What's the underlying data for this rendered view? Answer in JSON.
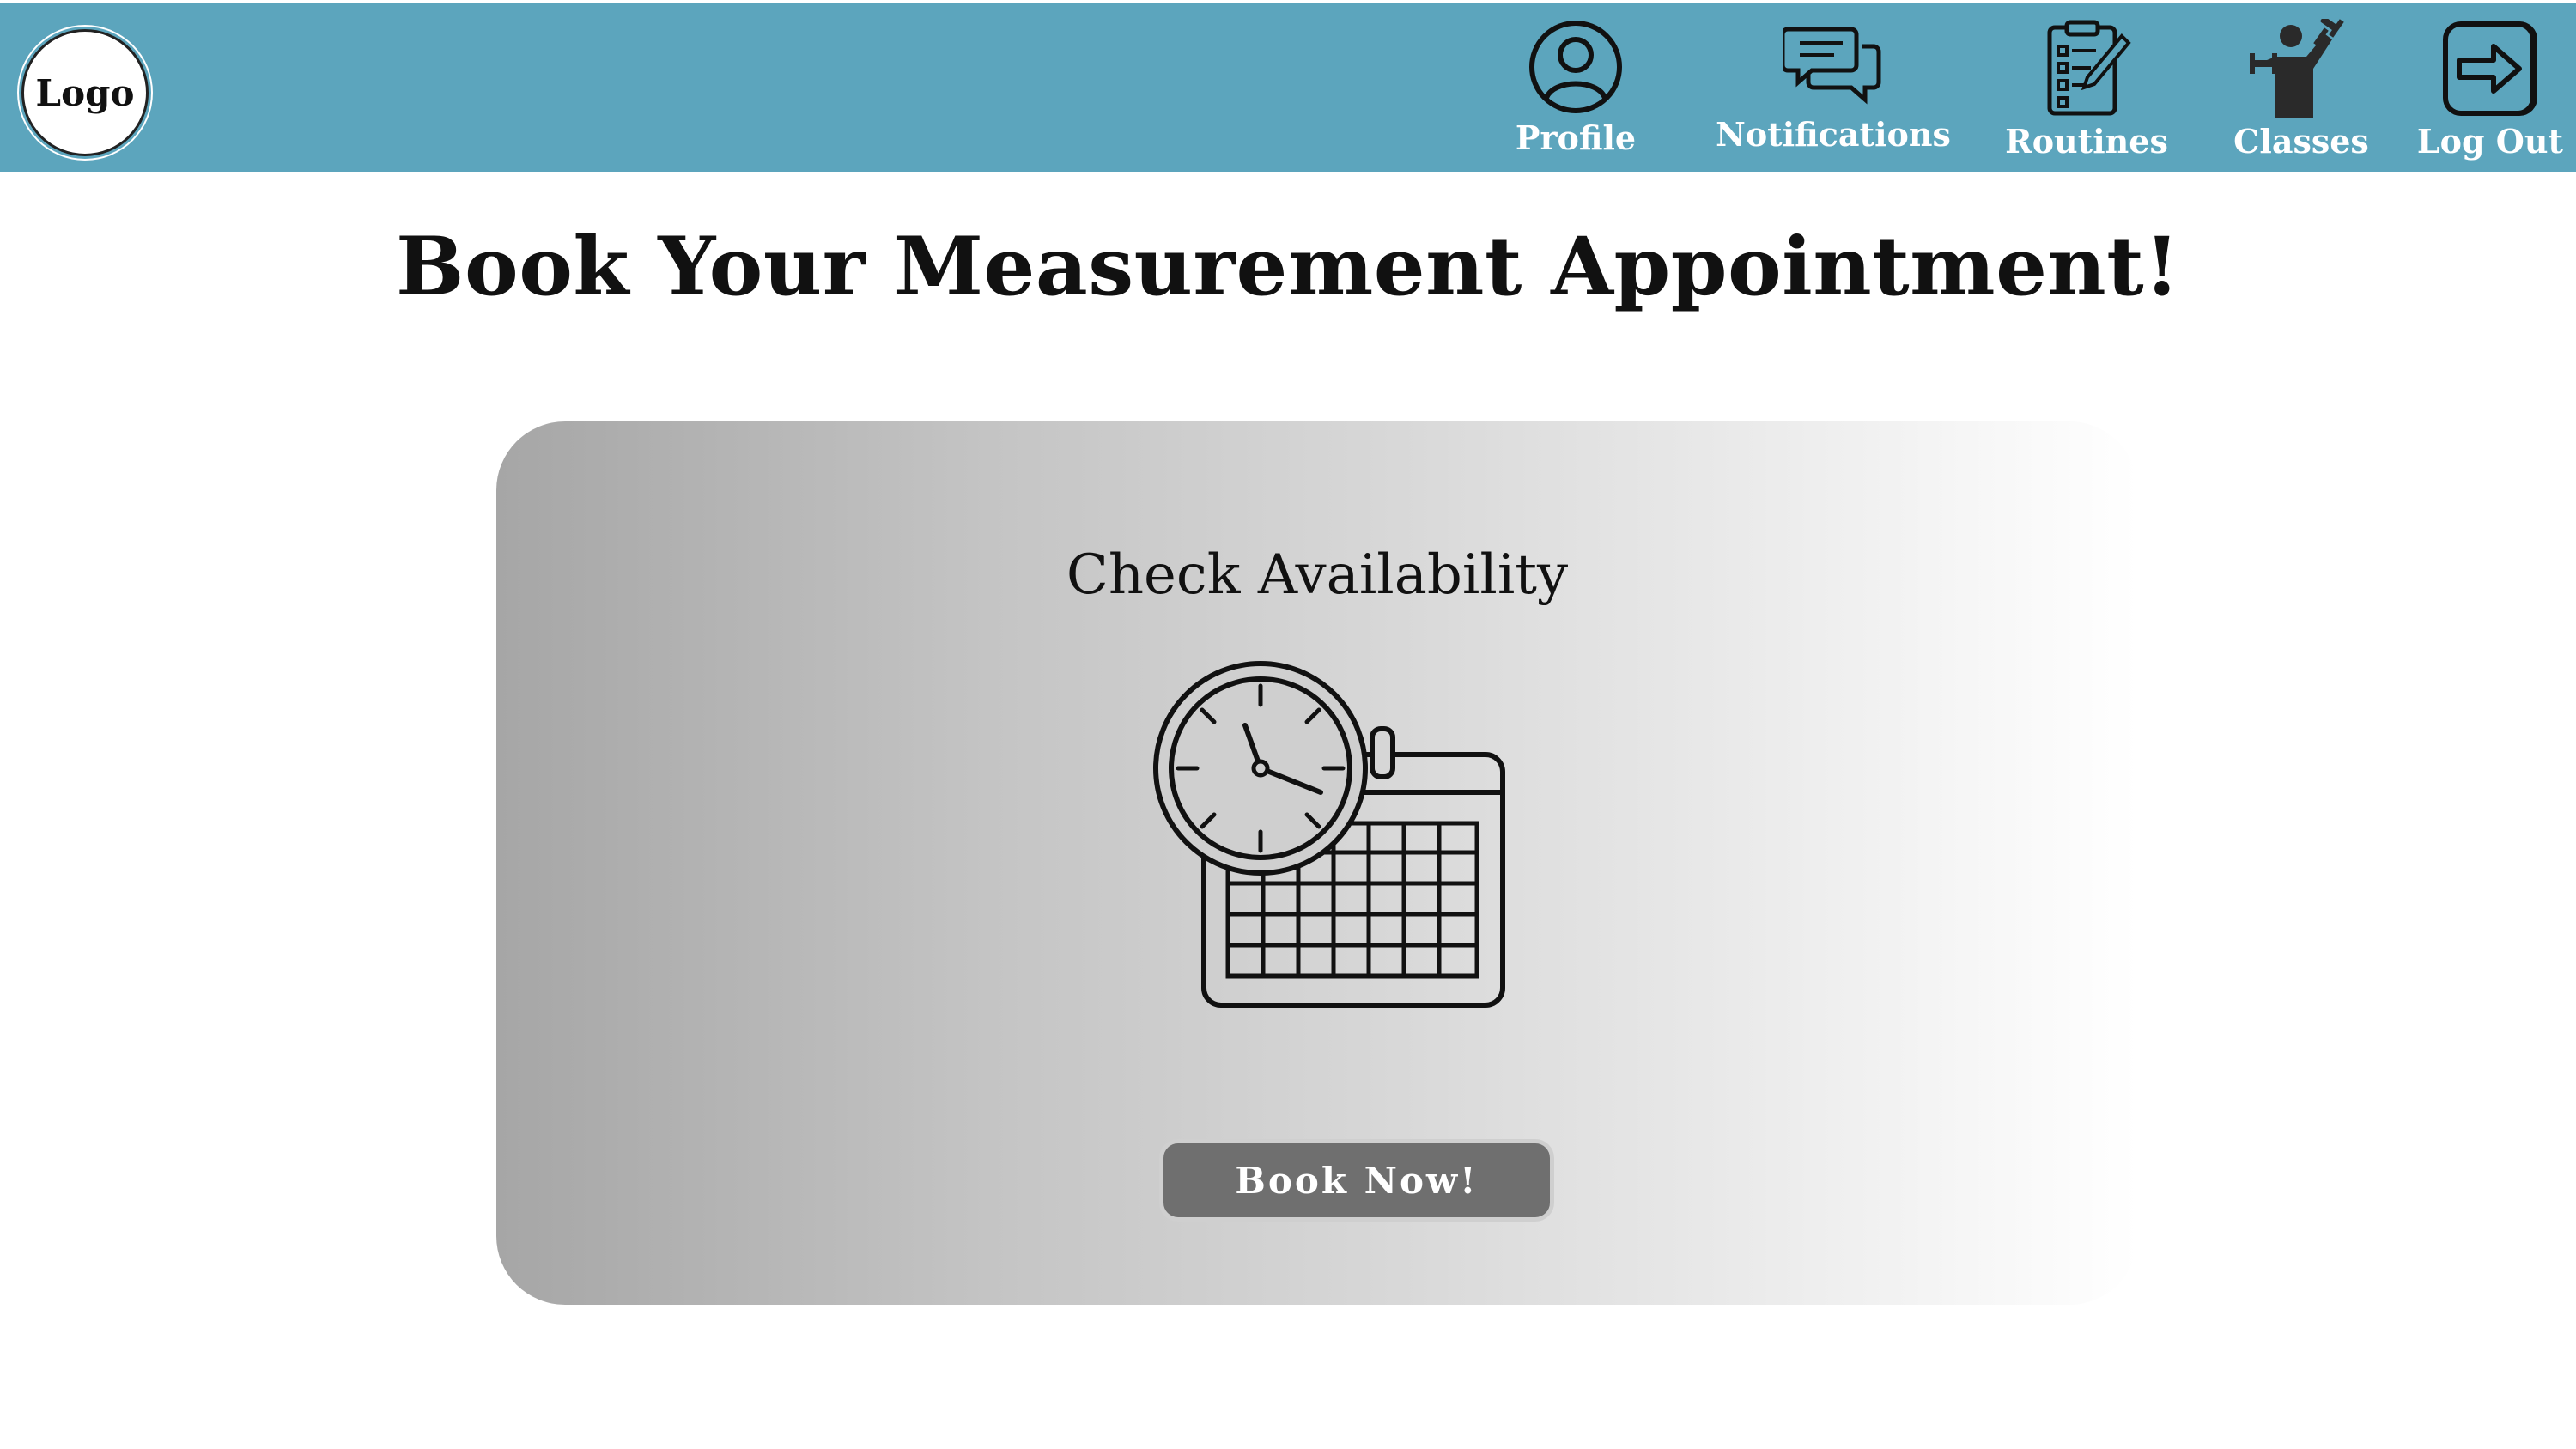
{
  "header": {
    "logo_text": "Logo",
    "background_color": "#5ca5bd",
    "nav": [
      {
        "label": "Profile",
        "icon": "user-circle-icon"
      },
      {
        "label": "Notifications",
        "icon": "chat-bubbles-icon"
      },
      {
        "label": "Routines",
        "icon": "clipboard-checklist-icon"
      },
      {
        "label": "Classes",
        "icon": "weightlifter-icon"
      },
      {
        "label": "Log Out",
        "icon": "logout-arrow-icon"
      }
    ]
  },
  "main": {
    "title": "Book Your Measurement Appointment!",
    "card": {
      "heading": "Check Availability",
      "icon": "clock-calendar-icon",
      "button_label": "Book Now!",
      "button_color": "#6f6f6f"
    }
  }
}
